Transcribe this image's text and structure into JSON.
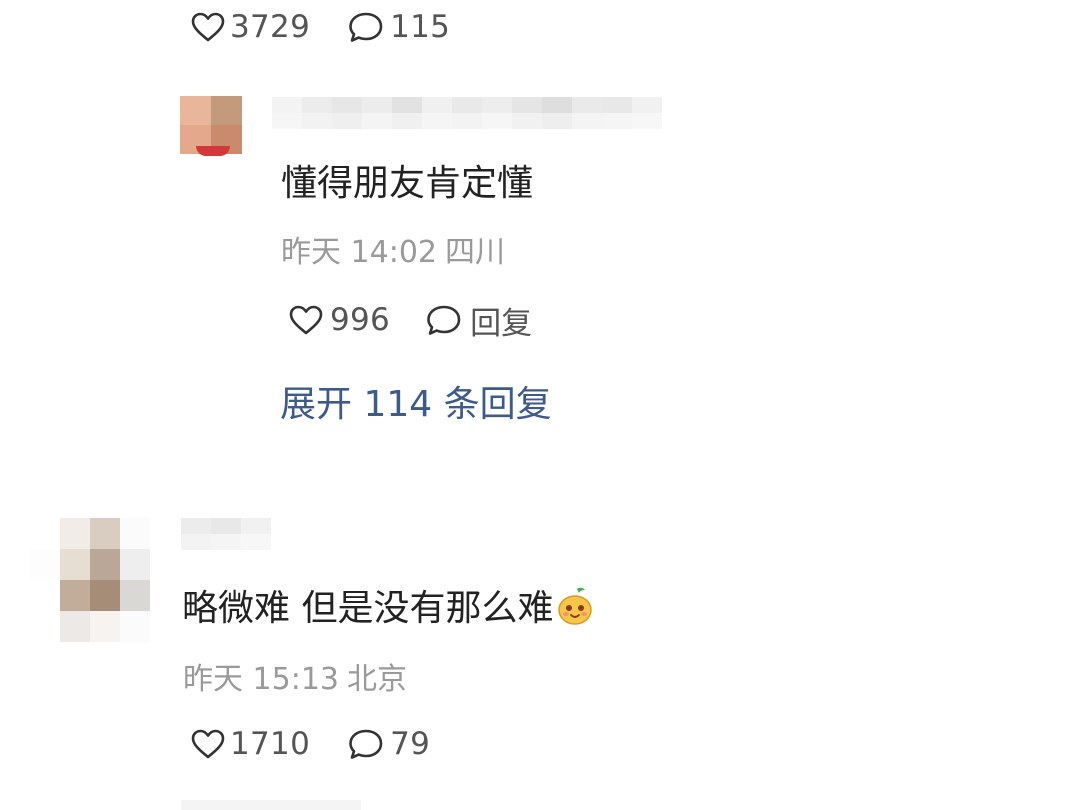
{
  "top_comment_actions": {
    "likes": "3729",
    "replies": "115"
  },
  "reply": {
    "text": "懂得朋友肯定懂",
    "time": "昨天 14:02",
    "location": "四川",
    "likes": "996",
    "reply_label": "回复",
    "expand_label": "展开 114 条回复"
  },
  "comment": {
    "text": "略微难 但是没有那么难",
    "emoji": "smiling-pear-emoji",
    "time": "昨天 15:13",
    "location": "北京",
    "likes": "1710",
    "replies": "79"
  },
  "icons": [
    "heart-icon",
    "comment-bubble-icon"
  ],
  "colors": {
    "text": "#222222",
    "meta": "#9a9a9a",
    "action": "#555555",
    "link": "#3d5a8c"
  }
}
